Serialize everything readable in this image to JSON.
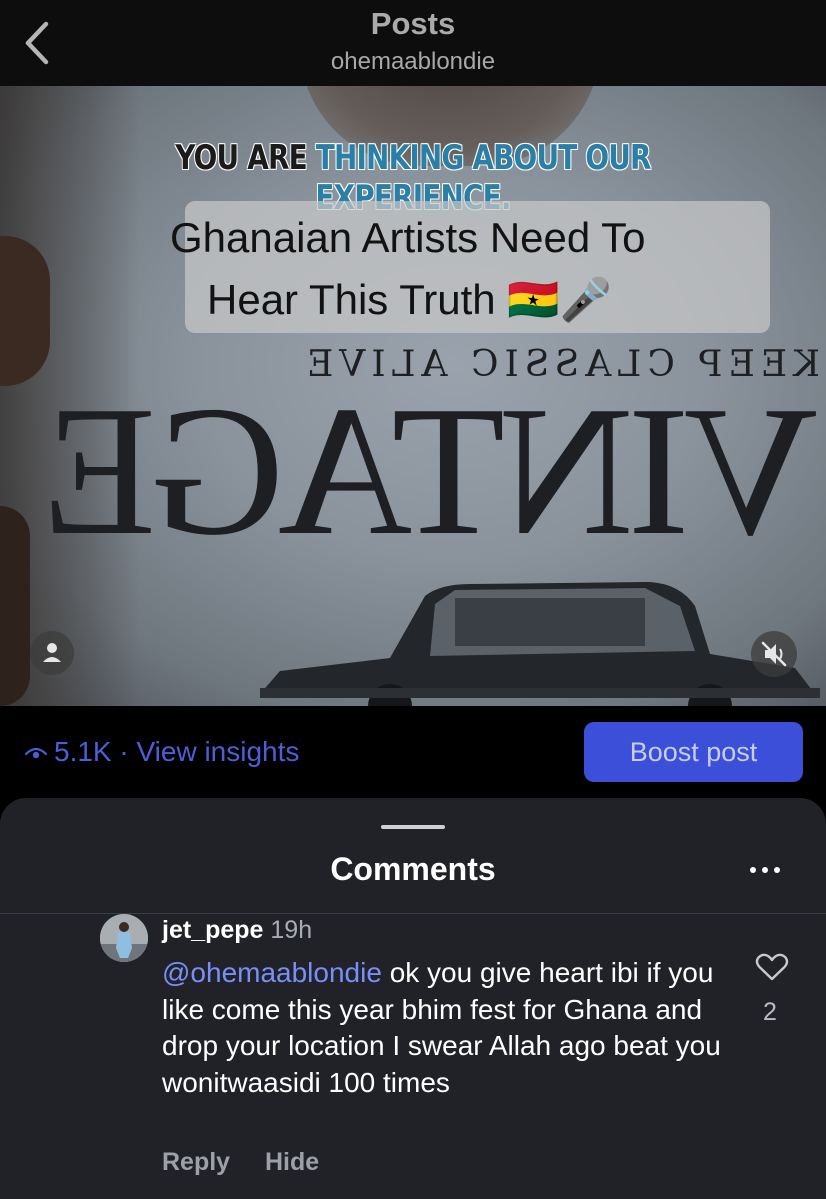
{
  "header": {
    "title": "Posts",
    "subtitle": "ohemaablondie"
  },
  "media": {
    "overlay_text_dark": "YOU ARE",
    "overlay_text_accent": "THINKING ABOUT OUR EXPERIENCE.",
    "caption_line1": "Ghanaian Artists Need To",
    "caption_line2": "Hear This Truth 🇬🇭🎤",
    "shirt_print_small": "KEEP CLASSIC ALIVE",
    "shirt_print_big": "VINTAGE"
  },
  "insights": {
    "views": "5.1K · View insights",
    "boost_label": "Boost post"
  },
  "comments_sheet": {
    "title": "Comments",
    "comment": {
      "username": "jet_pepe",
      "time": "19h",
      "mention": "@ohemaablondie",
      "text": " ok you give heart ibi if you like come this year bhim fest for Ghana and drop your location I swear Allah ago beat you wonitwaasidi 100 times",
      "likes": "2",
      "reply_label": "Reply",
      "hide_label": "Hide"
    }
  },
  "colors": {
    "accent_blue": "#3b4fd8",
    "mention_blue": "#7a8ef7",
    "sheet_bg": "#202228"
  }
}
